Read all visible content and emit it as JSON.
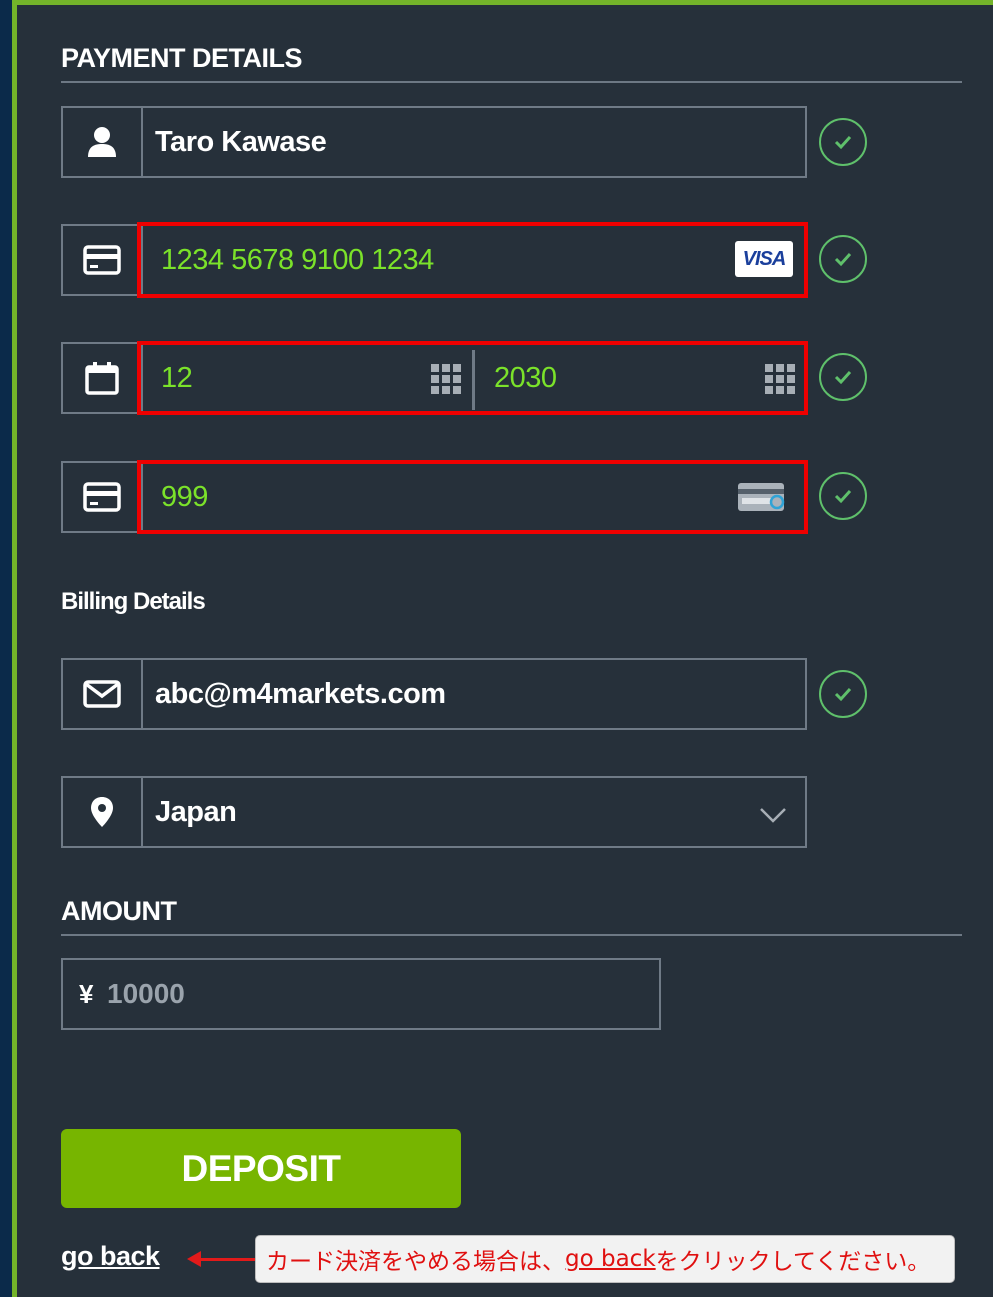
{
  "payment": {
    "title": "PAYMENT DETAILS",
    "name": "Taro Kawase",
    "card_number": "1234 5678 9100 1234",
    "card_brand": "VISA",
    "exp_month": "12",
    "exp_year": "2030",
    "cvv": "999"
  },
  "billing": {
    "title": "Billing Details",
    "email": "abc@m4markets.com",
    "country": "Japan"
  },
  "amount": {
    "title": "AMOUNT",
    "currency": "¥",
    "value": "10000"
  },
  "actions": {
    "deposit_label": "DEPOSIT",
    "go_back_label": "go back"
  },
  "note": {
    "prefix": "カード決済をやめる場合は、",
    "link": "go back",
    "suffix": "をクリックしてください。"
  },
  "icons": [
    "user-icon",
    "credit-card-icon",
    "calendar-icon",
    "cvv-card-icon",
    "envelope-icon",
    "location-pin-icon",
    "check-icon",
    "chevron-down-icon",
    "keypad-icon"
  ],
  "colors": {
    "panel_bg": "#26303a",
    "accent_green": "#77b500",
    "value_green": "#7be22a",
    "highlight_red": "#ef0000",
    "check_green": "#5fc06b"
  }
}
